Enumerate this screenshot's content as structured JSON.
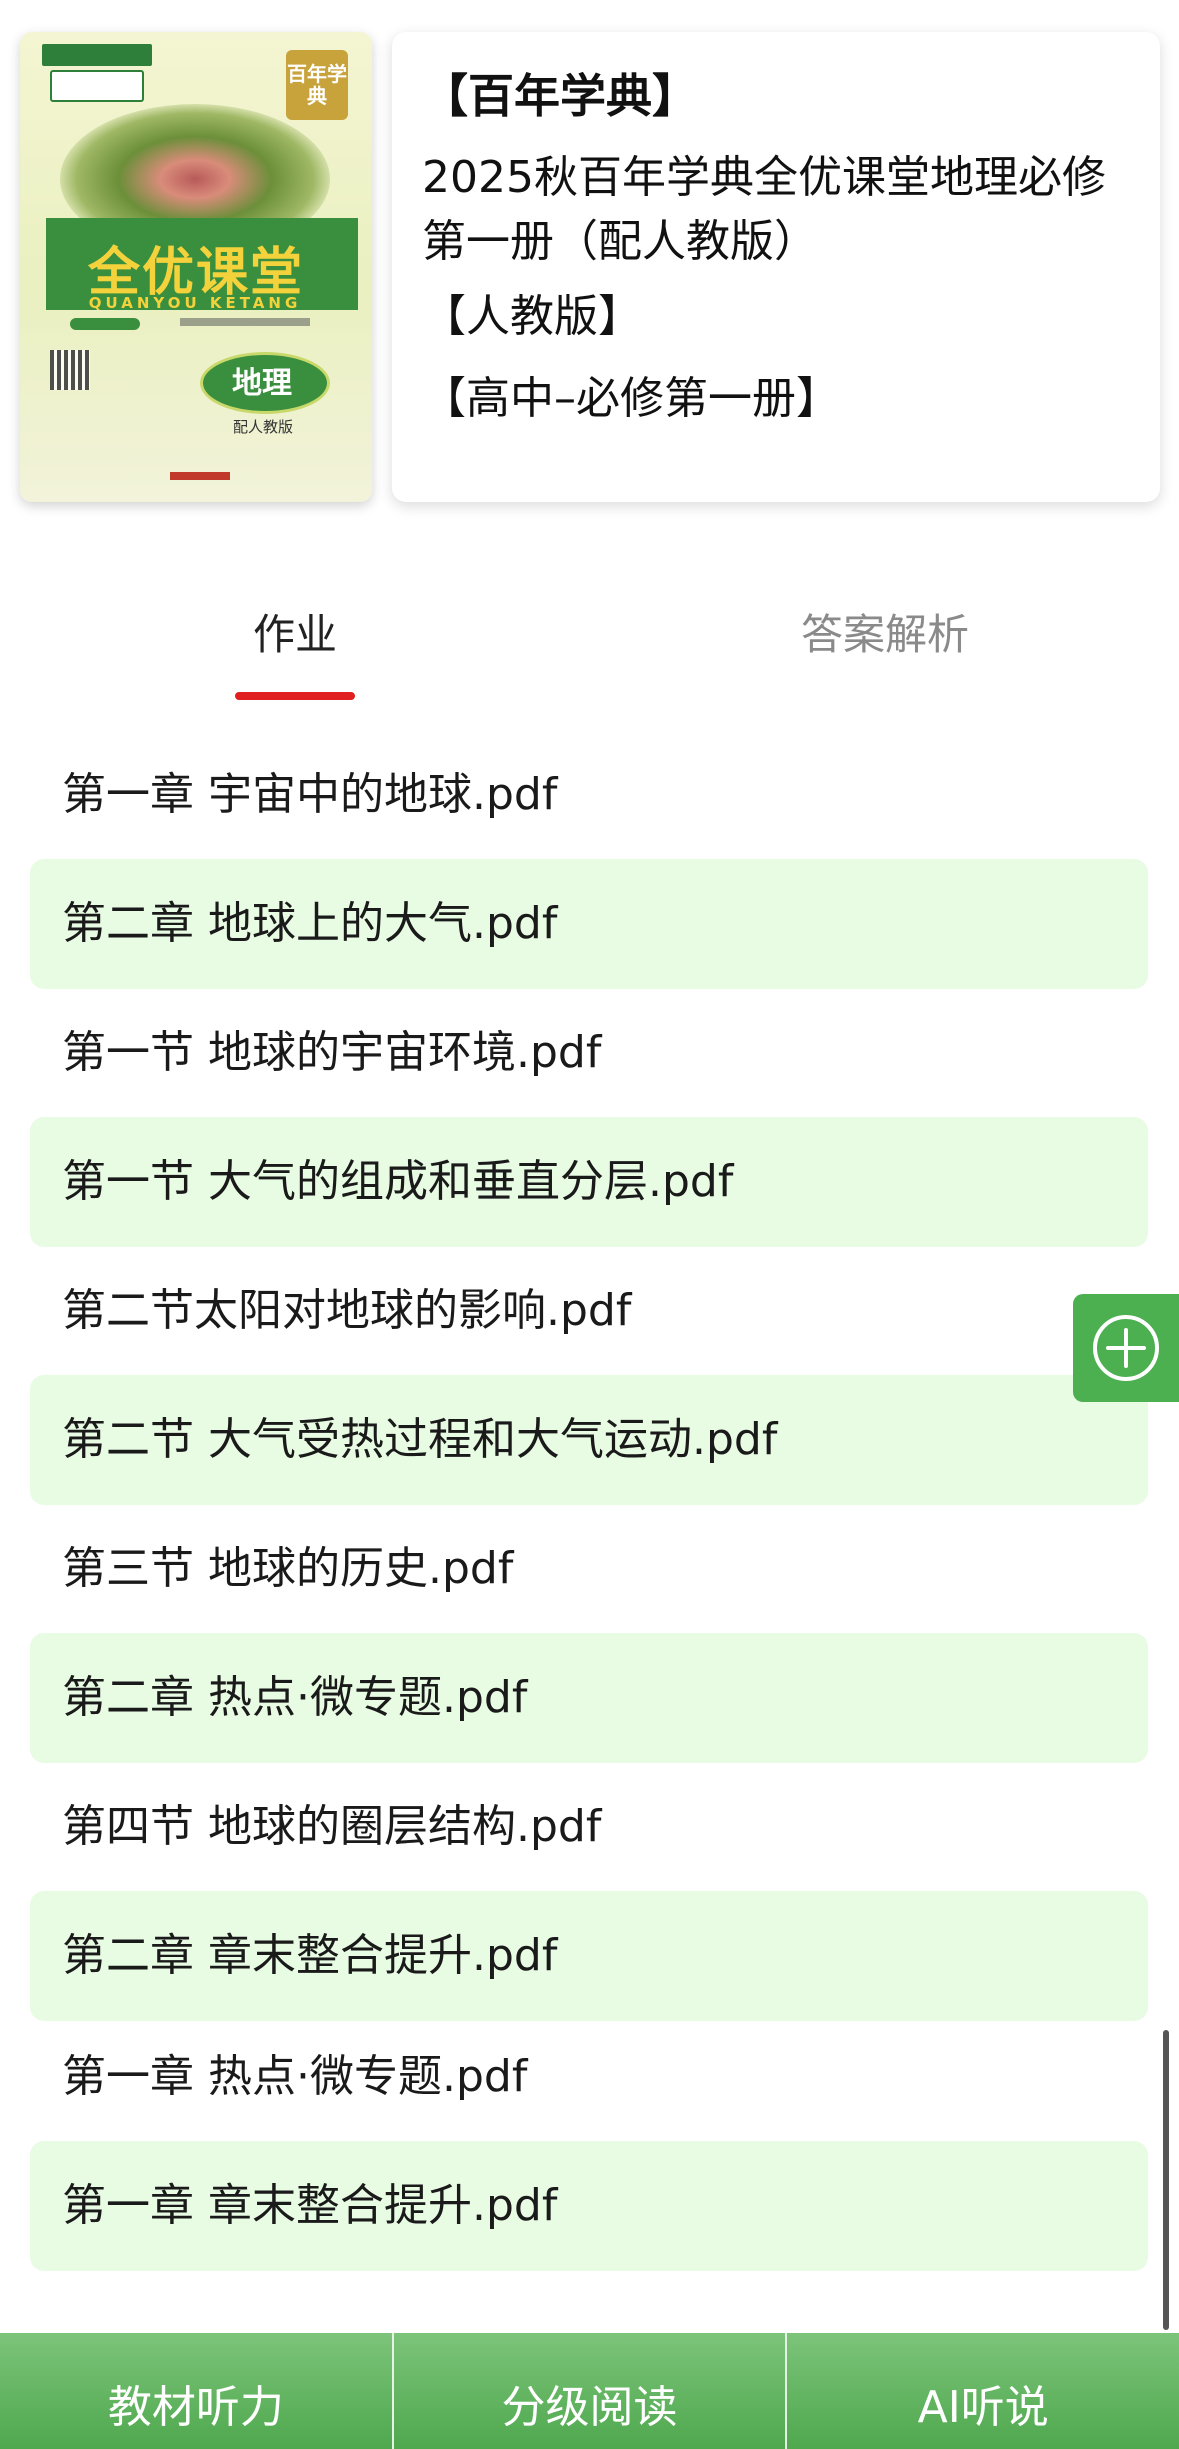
{
  "book": {
    "cover": {
      "badge": "百年学典",
      "title": "全优课堂",
      "subtitle": "QUANYOU KETANG",
      "subject": "地理",
      "edition": "配人教版"
    },
    "brand": "【百年学典】",
    "name": "2025秋百年学典全优课堂地理必修第一册（配人教版）",
    "version": "【人教版】",
    "grade": "【高中–必修第一册】"
  },
  "tabs": [
    {
      "label": "作业",
      "active": true
    },
    {
      "label": "答案解析",
      "active": false
    }
  ],
  "files": [
    "第一章 宇宙中的地球.pdf",
    "第二章 地球上的大气.pdf",
    "第一节 地球的宇宙环境.pdf",
    "第一节 大气的组成和垂直分层.pdf",
    "第二节太阳对地球的影响.pdf",
    "第二节 大气受热过程和大气运动.pdf",
    "第三节 地球的历史.pdf",
    "第二章 热点·微专题.pdf",
    "第四节 地球的圈层结构.pdf",
    "第二章 章末整合提升.pdf",
    "第一章 热点·微专题.pdf",
    "第一章 章末整合提升.pdf"
  ],
  "floating_action": {
    "icon": "plus-circle-icon"
  },
  "bottom_bar": [
    {
      "label": "教材听力"
    },
    {
      "label": "分级阅读"
    },
    {
      "label": "AI听说"
    }
  ],
  "colors": {
    "accent_green": "#4caf50",
    "row_highlight": "#e8fbe3",
    "tab_indicator": "#e02020"
  }
}
